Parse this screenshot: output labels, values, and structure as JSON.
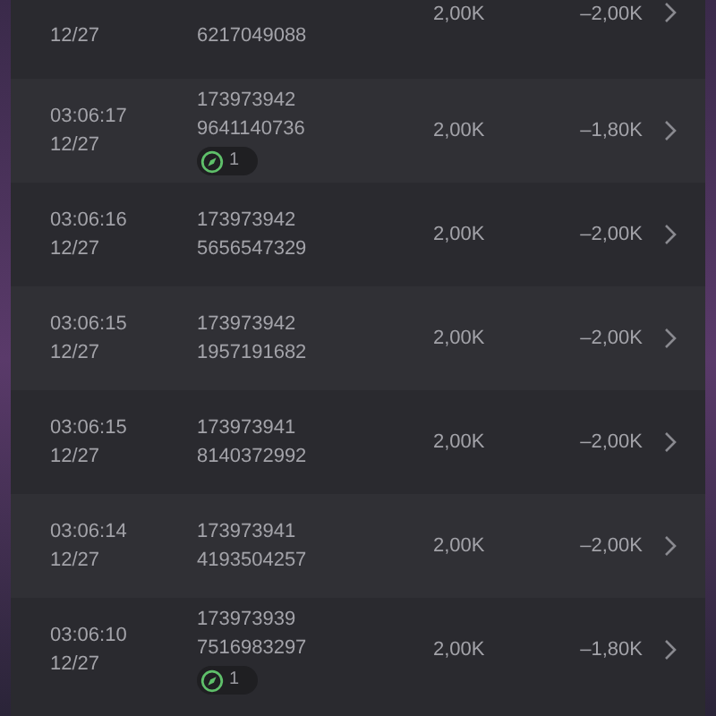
{
  "rows": [
    {
      "date": "12/27",
      "id_lines": [
        "6217049088"
      ],
      "amount": "2,00K",
      "change": "–2,00K"
    },
    {
      "time": "03:06:17",
      "date": "12/27",
      "id_lines": [
        "173973942",
        "9641140736"
      ],
      "badge": "1",
      "amount": "2,00K",
      "change": "–1,80K"
    },
    {
      "time": "03:06:16",
      "date": "12/27",
      "id_lines": [
        "173973942",
        "5656547329"
      ],
      "amount": "2,00K",
      "change": "–2,00K"
    },
    {
      "time": "03:06:15",
      "date": "12/27",
      "id_lines": [
        "173973942",
        "1957191682"
      ],
      "amount": "2,00K",
      "change": "–2,00K"
    },
    {
      "time": "03:06:15",
      "date": "12/27",
      "id_lines": [
        "173973941",
        "8140372992"
      ],
      "amount": "2,00K",
      "change": "–2,00K"
    },
    {
      "time": "03:06:14",
      "date": "12/27",
      "id_lines": [
        "173973941",
        "4193504257"
      ],
      "amount": "2,00K",
      "change": "–2,00K"
    },
    {
      "time": "03:06:10",
      "date": "12/27",
      "id_lines": [
        "173973939",
        "7516983297"
      ],
      "badge": "1",
      "amount": "2,00K",
      "change": "–1,80K"
    }
  ]
}
